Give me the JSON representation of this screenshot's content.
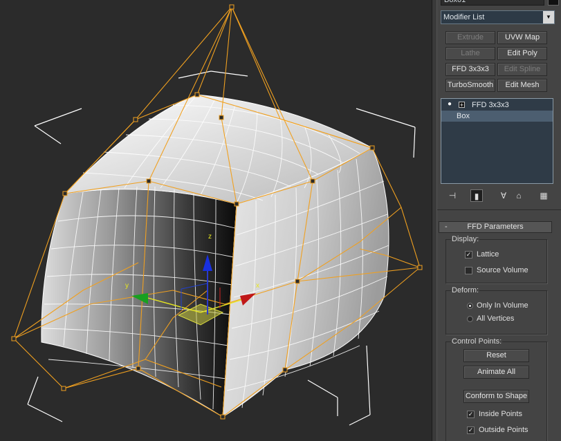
{
  "panel": {
    "name_field": "Box01",
    "modifier_list": "Modifier List",
    "buttons": [
      {
        "label": "Extrude",
        "disabled": true
      },
      {
        "label": "UVW Map",
        "disabled": false
      },
      {
        "label": "Lathe",
        "disabled": true
      },
      {
        "label": "Edit Poly",
        "disabled": false
      },
      {
        "label": "FFD 3x3x3",
        "disabled": false
      },
      {
        "label": "Edit Spline",
        "disabled": true
      },
      {
        "label": "TurboSmooth",
        "disabled": false
      },
      {
        "label": "Edit Mesh",
        "disabled": false
      }
    ],
    "stack": {
      "modifier": "FFD 3x3x3",
      "base": "Box"
    },
    "toolbar_icons": [
      "pin-stack-icon",
      "show-end-result-icon",
      "make-unique-icon",
      "remove-modifier-icon",
      "configure-sets-icon"
    ],
    "rollout": {
      "title": "FFD Parameters",
      "collapse": "-",
      "display": {
        "title": "Display:",
        "lattice": "Lattice",
        "lattice_checked": true,
        "source_volume": "Source Volume",
        "source_volume_checked": false
      },
      "deform": {
        "title": "Deform:",
        "only_in_volume": "Only In Volume",
        "all_vertices": "All Vertices",
        "selected": "only_in_volume"
      },
      "control_points": {
        "title": "Control Points:",
        "reset": "Reset",
        "animate_all": "Animate All",
        "conform": "Conform to Shape",
        "inside_points": "Inside Points",
        "inside_checked": true,
        "outside_points": "Outside Points",
        "outside_checked": true
      }
    }
  },
  "viewport": {
    "gizmo_labels": {
      "x": "x",
      "y": "y",
      "z": "z"
    },
    "lattice_color": "#f0a020",
    "background": "#2b2b2b"
  }
}
